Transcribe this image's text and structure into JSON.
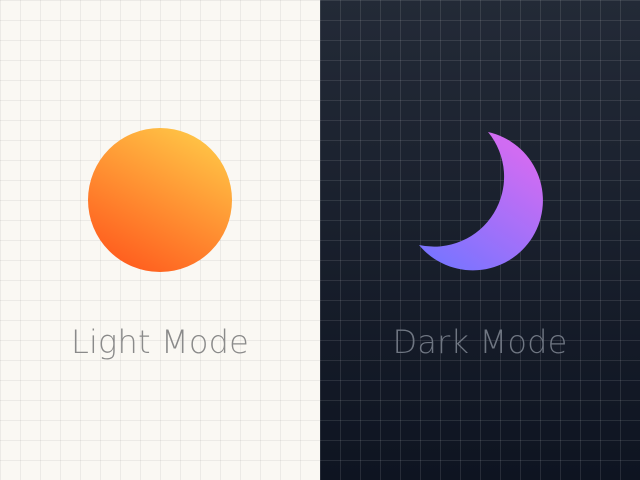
{
  "light_panel": {
    "label": "Light Mode",
    "icon": "sun-icon",
    "background": "#faf8f3",
    "icon_gradient": [
      "#ffc245",
      "#ff5f1f"
    ],
    "label_color": "#8a8a8a"
  },
  "dark_panel": {
    "label": "Dark Mode",
    "icon": "moon-icon",
    "background": "#141a26",
    "icon_gradient": [
      "#d06cf2",
      "#7b74ff"
    ],
    "label_color": "#6f7682"
  }
}
